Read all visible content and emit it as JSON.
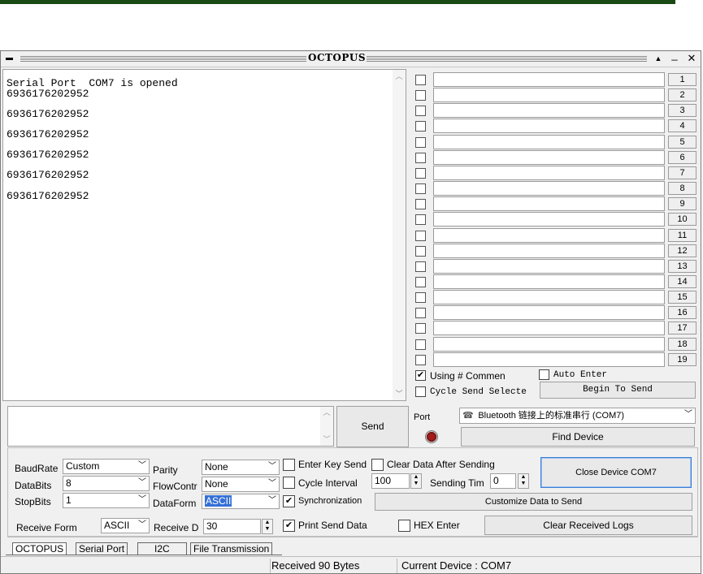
{
  "window": {
    "title": "OCTOPUS",
    "controls": [
      "▲",
      "_",
      "✕"
    ]
  },
  "receive": {
    "lines": [
      "Serial Port  COM7 is opened",
      "6936176202952",
      "",
      "6936176202952",
      "",
      "6936176202952",
      "",
      "6936176202952",
      "",
      "6936176202952",
      "",
      "6936176202952"
    ]
  },
  "send_rows": [
    "1",
    "2",
    "3",
    "4",
    "5",
    "6",
    "7",
    "8",
    "9",
    "10",
    "11",
    "12",
    "13",
    "14",
    "15",
    "16",
    "17",
    "18",
    "19"
  ],
  "right_options": {
    "using_label": "Using # Commen",
    "using_checked": true,
    "auto_enter_label": "Auto Enter",
    "cycle_label": "Cycle Send Selecte",
    "begin_label": "Begin To Send"
  },
  "send": {
    "button_label": "Send"
  },
  "port": {
    "label": "Port",
    "value": "Bluetooth 链接上的标准串行 (COM7)",
    "find_label": "Find Device"
  },
  "settings": {
    "baud_label": "BaudRate",
    "baud_value": "Custom",
    "databits_label": "DataBits",
    "databits_value": "8",
    "stopbits_label": "StopBits",
    "stopbits_value": "1",
    "parity_label": "Parity",
    "parity_value": "None",
    "flow_label": "FlowContr",
    "flow_value": "None",
    "dataform_label": "DataForm",
    "dataform_value": "ASCII",
    "enter_key_label": "Enter Key Send",
    "clear_after_label": "Clear Data After Sending",
    "cycle_interval_label": "Cycle Interval",
    "cycle_interval_value": "100",
    "sending_time_label": "Sending Tim",
    "sending_time_value": "0",
    "sync_label": "Synchronization",
    "sync_checked": true,
    "close_device_label": "Close Device COM7",
    "customize_label": "Customize Data to Send"
  },
  "bottom": {
    "receive_form_label": "Receive Form",
    "receive_form_value": "ASCII",
    "receive_d_label": "Receive D",
    "receive_d_value": "30",
    "print_send_label": "Print Send Data",
    "print_send_checked": true,
    "hex_enter_label": "HEX Enter",
    "clear_logs_label": "Clear Received Logs"
  },
  "tabs": [
    "OCTOPUS",
    "Serial Port",
    "I2C",
    "File Transmission"
  ],
  "status": {
    "received": "Received 90 Bytes",
    "current": "Current Device :  COM7"
  }
}
